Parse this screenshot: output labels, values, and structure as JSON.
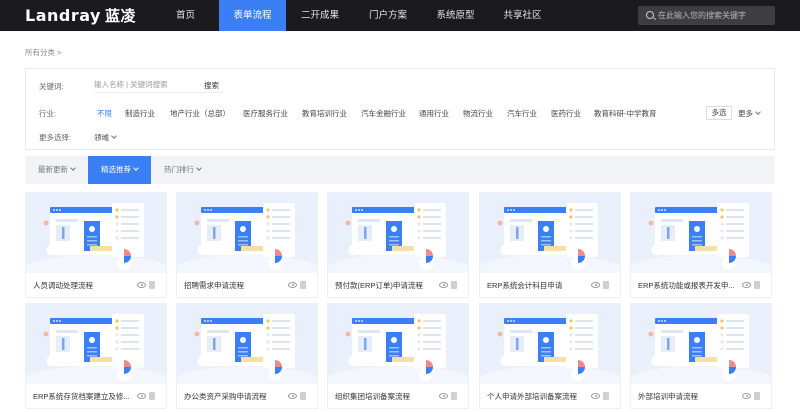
{
  "nav": {
    "logo_text": "Landray",
    "logo_cn": "蓝凌",
    "items": [
      {
        "label": "首页"
      },
      {
        "label": "表单流程"
      },
      {
        "label": "二开成果"
      },
      {
        "label": "门户方案"
      },
      {
        "label": "系统原型"
      },
      {
        "label": "共享社区"
      }
    ],
    "active_index": 1,
    "search_placeholder": "在此输入您的搜索关键字"
  },
  "breadcrumb": "所有分类 >",
  "filters": {
    "keyword_label": "关键词:",
    "keyword_placeholder": "输入名称 | 关键词搜索",
    "keyword_button": "搜索",
    "industry_label": "行业:",
    "industries": [
      {
        "label": "不限",
        "selected": true
      },
      {
        "label": "制造行业"
      },
      {
        "label": "地产行业（总部）"
      },
      {
        "label": "医疗服务行业"
      },
      {
        "label": "教育培训行业"
      },
      {
        "label": "汽车金融行业"
      },
      {
        "label": "通用行业"
      },
      {
        "label": "物流行业"
      },
      {
        "label": "汽车行业"
      },
      {
        "label": "医药行业"
      },
      {
        "label": "教育科研-中学教育"
      }
    ],
    "multi_select": "多选",
    "more": "更多",
    "more_options_label": "更多选择:",
    "domain_dropdown": "领域"
  },
  "sort_tabs": [
    {
      "label": "最新更新"
    },
    {
      "label": "精选推荐"
    },
    {
      "label": "热门排行"
    }
  ],
  "sort_active_index": 1,
  "cards": [
    {
      "title": "人员调动处理流程"
    },
    {
      "title": "招聘需求申请流程"
    },
    {
      "title": "预付款(ERP订单)申请流程"
    },
    {
      "title": "ERP系统会计科目申请"
    },
    {
      "title": "ERP系统功能或报表开发申..."
    },
    {
      "title": "ERP系统存货档案建立及修..."
    },
    {
      "title": "办公类资产采购申请流程"
    },
    {
      "title": "组织集团培训备案流程"
    },
    {
      "title": "个人申请外部培训备案流程"
    },
    {
      "title": "外部培训申请流程"
    }
  ],
  "colors": {
    "nav_bg": "#1b1b1f",
    "accent": "#3b7ff5",
    "thumb_bg": "#eaf0fb"
  }
}
